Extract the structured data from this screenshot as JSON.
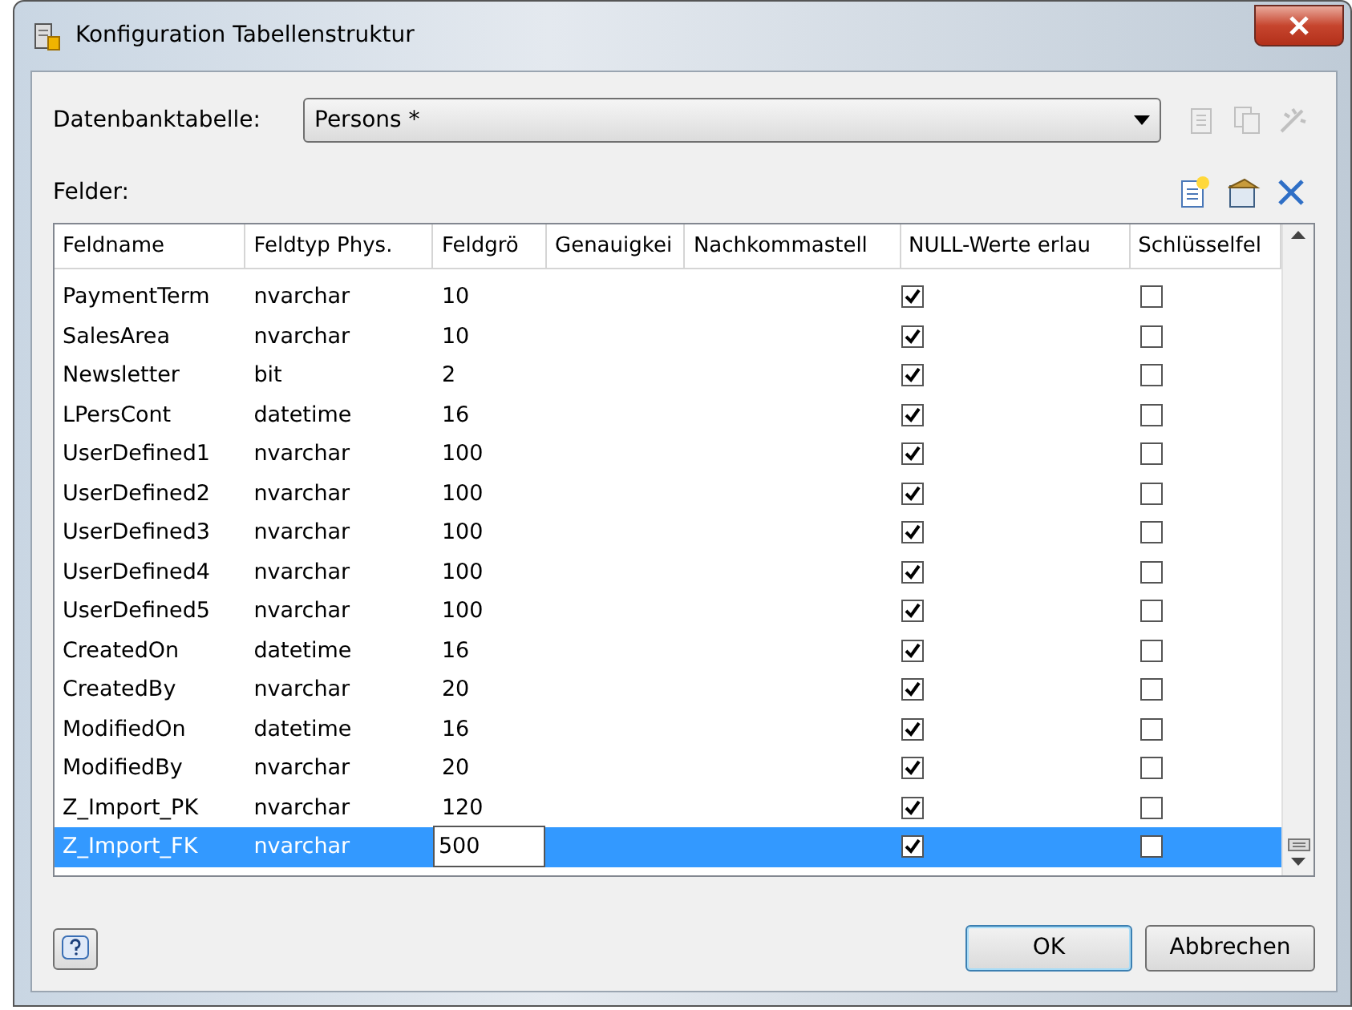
{
  "window": {
    "title": "Konfiguration Tabellenstruktur"
  },
  "table_select": {
    "label": "Datenbanktabelle:",
    "value": "Persons *"
  },
  "fields_label": "Felder:",
  "columns": [
    "Feldname",
    "Feldtyp Phys.",
    "Feldgrö",
    "Genauigkei",
    "Nachkommastell",
    "NULL-Werte erlau",
    "Schlüsselfel"
  ],
  "rows": [
    {
      "name": "PaymentTerm",
      "type": "nvarchar",
      "size": "10",
      "null_allowed": true,
      "key": false,
      "selected": false
    },
    {
      "name": "SalesArea",
      "type": "nvarchar",
      "size": "10",
      "null_allowed": true,
      "key": false,
      "selected": false
    },
    {
      "name": "Newsletter",
      "type": "bit",
      "size": "2",
      "null_allowed": true,
      "key": false,
      "selected": false
    },
    {
      "name": "LPersCont",
      "type": "datetime",
      "size": "16",
      "null_allowed": true,
      "key": false,
      "selected": false
    },
    {
      "name": "UserDefined1",
      "type": "nvarchar",
      "size": "100",
      "null_allowed": true,
      "key": false,
      "selected": false
    },
    {
      "name": "UserDefined2",
      "type": "nvarchar",
      "size": "100",
      "null_allowed": true,
      "key": false,
      "selected": false
    },
    {
      "name": "UserDefined3",
      "type": "nvarchar",
      "size": "100",
      "null_allowed": true,
      "key": false,
      "selected": false
    },
    {
      "name": "UserDefined4",
      "type": "nvarchar",
      "size": "100",
      "null_allowed": true,
      "key": false,
      "selected": false
    },
    {
      "name": "UserDefined5",
      "type": "nvarchar",
      "size": "100",
      "null_allowed": true,
      "key": false,
      "selected": false
    },
    {
      "name": "CreatedOn",
      "type": "datetime",
      "size": "16",
      "null_allowed": true,
      "key": false,
      "selected": false
    },
    {
      "name": "CreatedBy",
      "type": "nvarchar",
      "size": "20",
      "null_allowed": true,
      "key": false,
      "selected": false
    },
    {
      "name": "ModifiedOn",
      "type": "datetime",
      "size": "16",
      "null_allowed": true,
      "key": false,
      "selected": false
    },
    {
      "name": "ModifiedBy",
      "type": "nvarchar",
      "size": "20",
      "null_allowed": true,
      "key": false,
      "selected": false
    },
    {
      "name": "Z_Import_PK",
      "type": "nvarchar",
      "size": "120",
      "null_allowed": true,
      "key": false,
      "selected": false
    },
    {
      "name": "Z_Import_FK",
      "type": "nvarchar",
      "size": "500",
      "null_allowed": true,
      "key": false,
      "selected": true
    }
  ],
  "buttons": [
    "OK",
    "Abbrechen"
  ]
}
